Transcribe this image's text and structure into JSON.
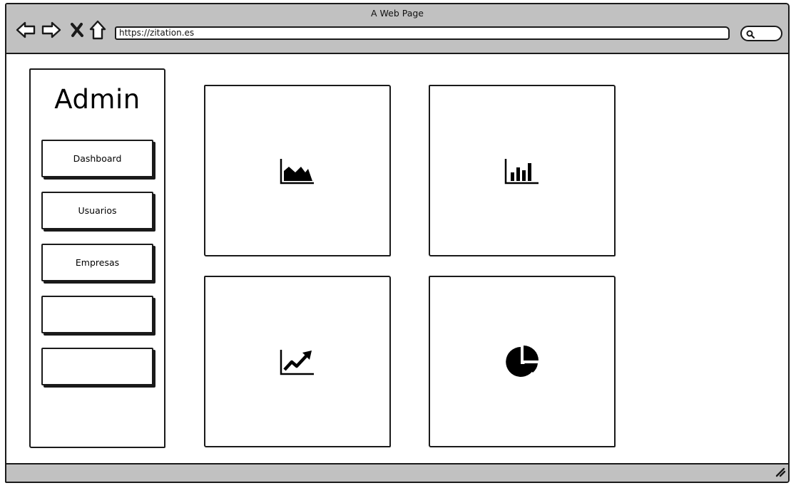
{
  "window": {
    "title": "A Web Page",
    "url": "https://zitation.es"
  },
  "toolbar": {
    "icons": [
      "back-arrow-icon",
      "forward-arrow-icon",
      "close-x-icon",
      "home-icon",
      "search-icon"
    ]
  },
  "sidebar": {
    "title": "Admin",
    "items": [
      {
        "label": "Dashboard"
      },
      {
        "label": "Usuarios"
      },
      {
        "label": "Empresas"
      },
      {
        "label": ""
      },
      {
        "label": ""
      }
    ]
  },
  "cards": [
    {
      "icon": "area-chart-icon"
    },
    {
      "icon": "bar-chart-icon"
    },
    {
      "icon": "line-chart-icon"
    },
    {
      "icon": "pie-chart-icon"
    }
  ],
  "colors": {
    "chrome": "#c1c1c1",
    "stroke": "#1a1a1a",
    "background": "#ffffff"
  }
}
